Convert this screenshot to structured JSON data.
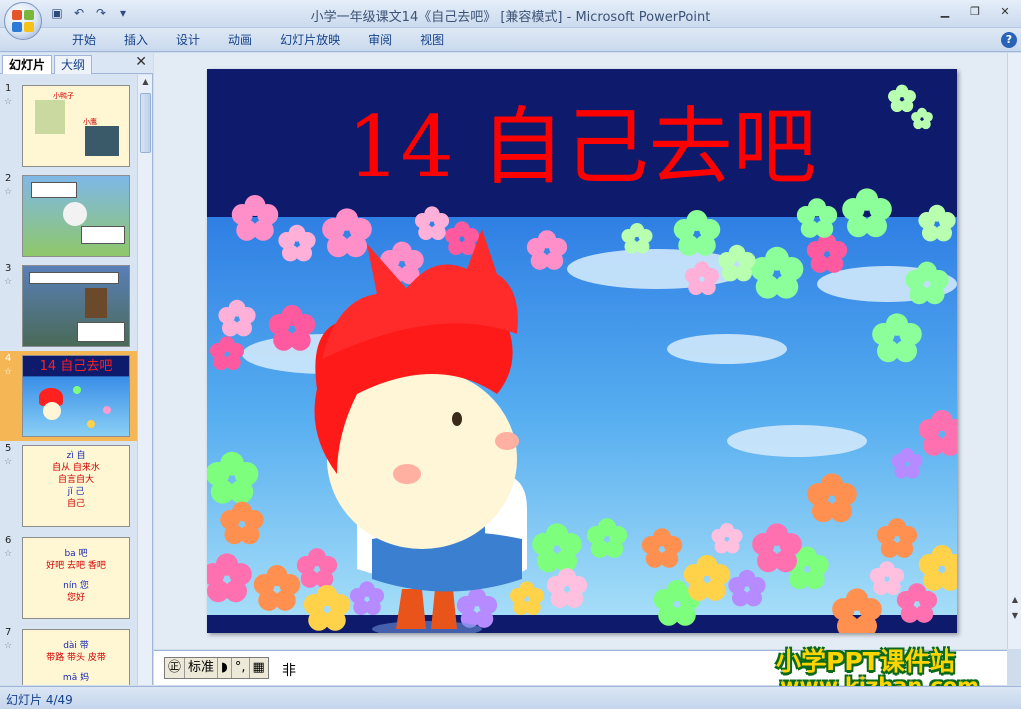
{
  "window": {
    "title": "小学一年级课文14《自己去吧》 [兼容模式] - Microsoft PowerPoint"
  },
  "ribbon": {
    "tabs": [
      {
        "label": "开始"
      },
      {
        "label": "插入"
      },
      {
        "label": "设计"
      },
      {
        "label": "动画"
      },
      {
        "label": "幻灯片放映"
      },
      {
        "label": "审阅"
      },
      {
        "label": "视图"
      }
    ]
  },
  "pane": {
    "tab_slides": "幻灯片",
    "tab_outline": "大纲"
  },
  "thumbnails": [
    {
      "num": "1",
      "lines": [
        "小鸭子",
        "小鹰"
      ]
    },
    {
      "num": "2",
      "lines": []
    },
    {
      "num": "3",
      "lines": []
    },
    {
      "num": "4",
      "lines": [
        "14 自己去吧"
      ]
    },
    {
      "num": "5",
      "lines": [
        "zì 自",
        "自从  自来水",
        "自言自大",
        "jǐ 己",
        "自己"
      ]
    },
    {
      "num": "6",
      "lines": [
        "ba 吧",
        "好吧 去吧 香吧",
        "nín 您",
        "您好"
      ]
    },
    {
      "num": "7",
      "lines": [
        "dài 带",
        "带路 带头 皮带",
        "mā 妈"
      ]
    }
  ],
  "slide": {
    "title": "14 自己去吧"
  },
  "notes": {
    "ime": [
      "标准"
    ],
    "text": "非"
  },
  "watermark": {
    "line1": "小学PPT课件站",
    "line2": "www.kjzhan.com"
  },
  "status": {
    "slide_counter": "幻灯片 4/49"
  },
  "colors": {
    "slide_top": "#0e1a6b",
    "sky": "#3a8ee8",
    "title_red": "#ff0000",
    "selected_thumb": "#f5b756"
  }
}
